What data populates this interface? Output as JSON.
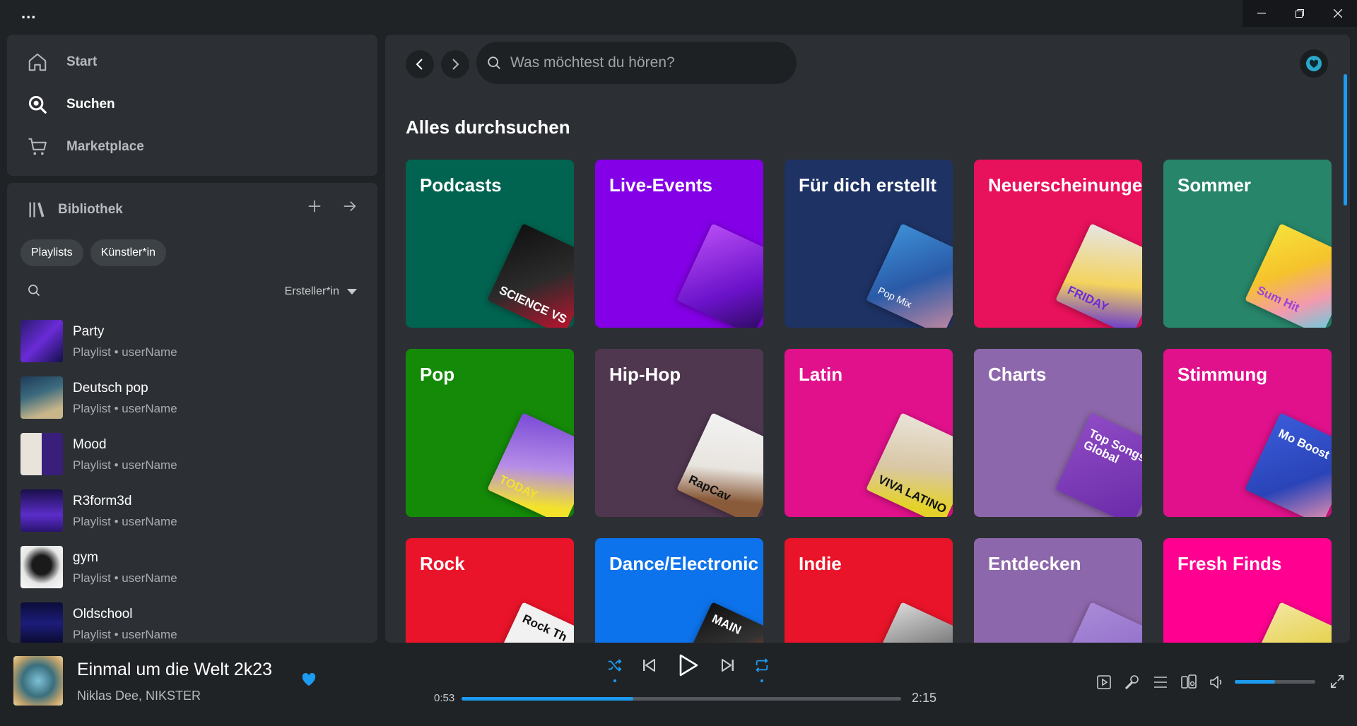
{
  "titlebar": {
    "menu": "..."
  },
  "nav": {
    "items": [
      {
        "label": "Start",
        "icon": "home-icon"
      },
      {
        "label": "Suchen",
        "icon": "search-icon"
      },
      {
        "label": "Marketplace",
        "icon": "cart-icon"
      }
    ]
  },
  "library": {
    "title": "Bibliothek",
    "chips": [
      "Playlists",
      "Künstler*in"
    ],
    "sort_label": "Ersteller*in",
    "items": [
      {
        "title": "Party",
        "subtitle": "Playlist • userName"
      },
      {
        "title": "Deutsch pop",
        "subtitle": "Playlist • userName"
      },
      {
        "title": "Mood",
        "subtitle": "Playlist • userName"
      },
      {
        "title": "R3form3d",
        "subtitle": "Playlist • userName"
      },
      {
        "title": "gym",
        "subtitle": "Playlist • userName"
      },
      {
        "title": "Oldschool",
        "subtitle": "Playlist • userName"
      }
    ]
  },
  "search": {
    "placeholder": "Was möchtest du hören?"
  },
  "browse": {
    "title": "Alles durchsuchen",
    "tiles": [
      {
        "label": "Podcasts",
        "color": "#006450",
        "art": "SCIENCE VS"
      },
      {
        "label": "Live-Events",
        "color": "#8400e7",
        "art": ""
      },
      {
        "label": "Für dich erstellt",
        "color": "#1e3264",
        "art": "Pop Mix"
      },
      {
        "label": "Neuerscheinungen",
        "color": "#e8115b",
        "art": "FRIDAY"
      },
      {
        "label": "Sommer",
        "color": "#27856a",
        "art": "Sum Hit"
      },
      {
        "label": "Pop",
        "color": "#148a08",
        "art": "TODAY"
      },
      {
        "label": "Hip-Hop",
        "color": "#503750",
        "art": "RapCav"
      },
      {
        "label": "Latin",
        "color": "#e1118c",
        "art": "VIVA LATINO"
      },
      {
        "label": "Charts",
        "color": "#8d67ab",
        "art": "Top Songs Global"
      },
      {
        "label": "Stimmung",
        "color": "#e1118c",
        "art": "Mo Boost"
      },
      {
        "label": "Rock",
        "color": "#e91429",
        "art": "Rock Th"
      },
      {
        "label": "Dance/Electronic",
        "color": "#0d73ec",
        "art": "MAIN"
      },
      {
        "label": "Indie",
        "color": "#e91429",
        "art": ""
      },
      {
        "label": "Entdecken",
        "color": "#8d67ab",
        "art": ""
      },
      {
        "label": "Fresh Finds",
        "color": "#ff0090",
        "art": ""
      }
    ]
  },
  "player": {
    "title": "Einmal um die Welt 2k23",
    "artist": "Niklas Dee, NIKSTER",
    "elapsed": "0:53",
    "duration": "2:15",
    "progress_percent": 39,
    "volume_percent": 50,
    "accent": "#1d9bf0"
  }
}
